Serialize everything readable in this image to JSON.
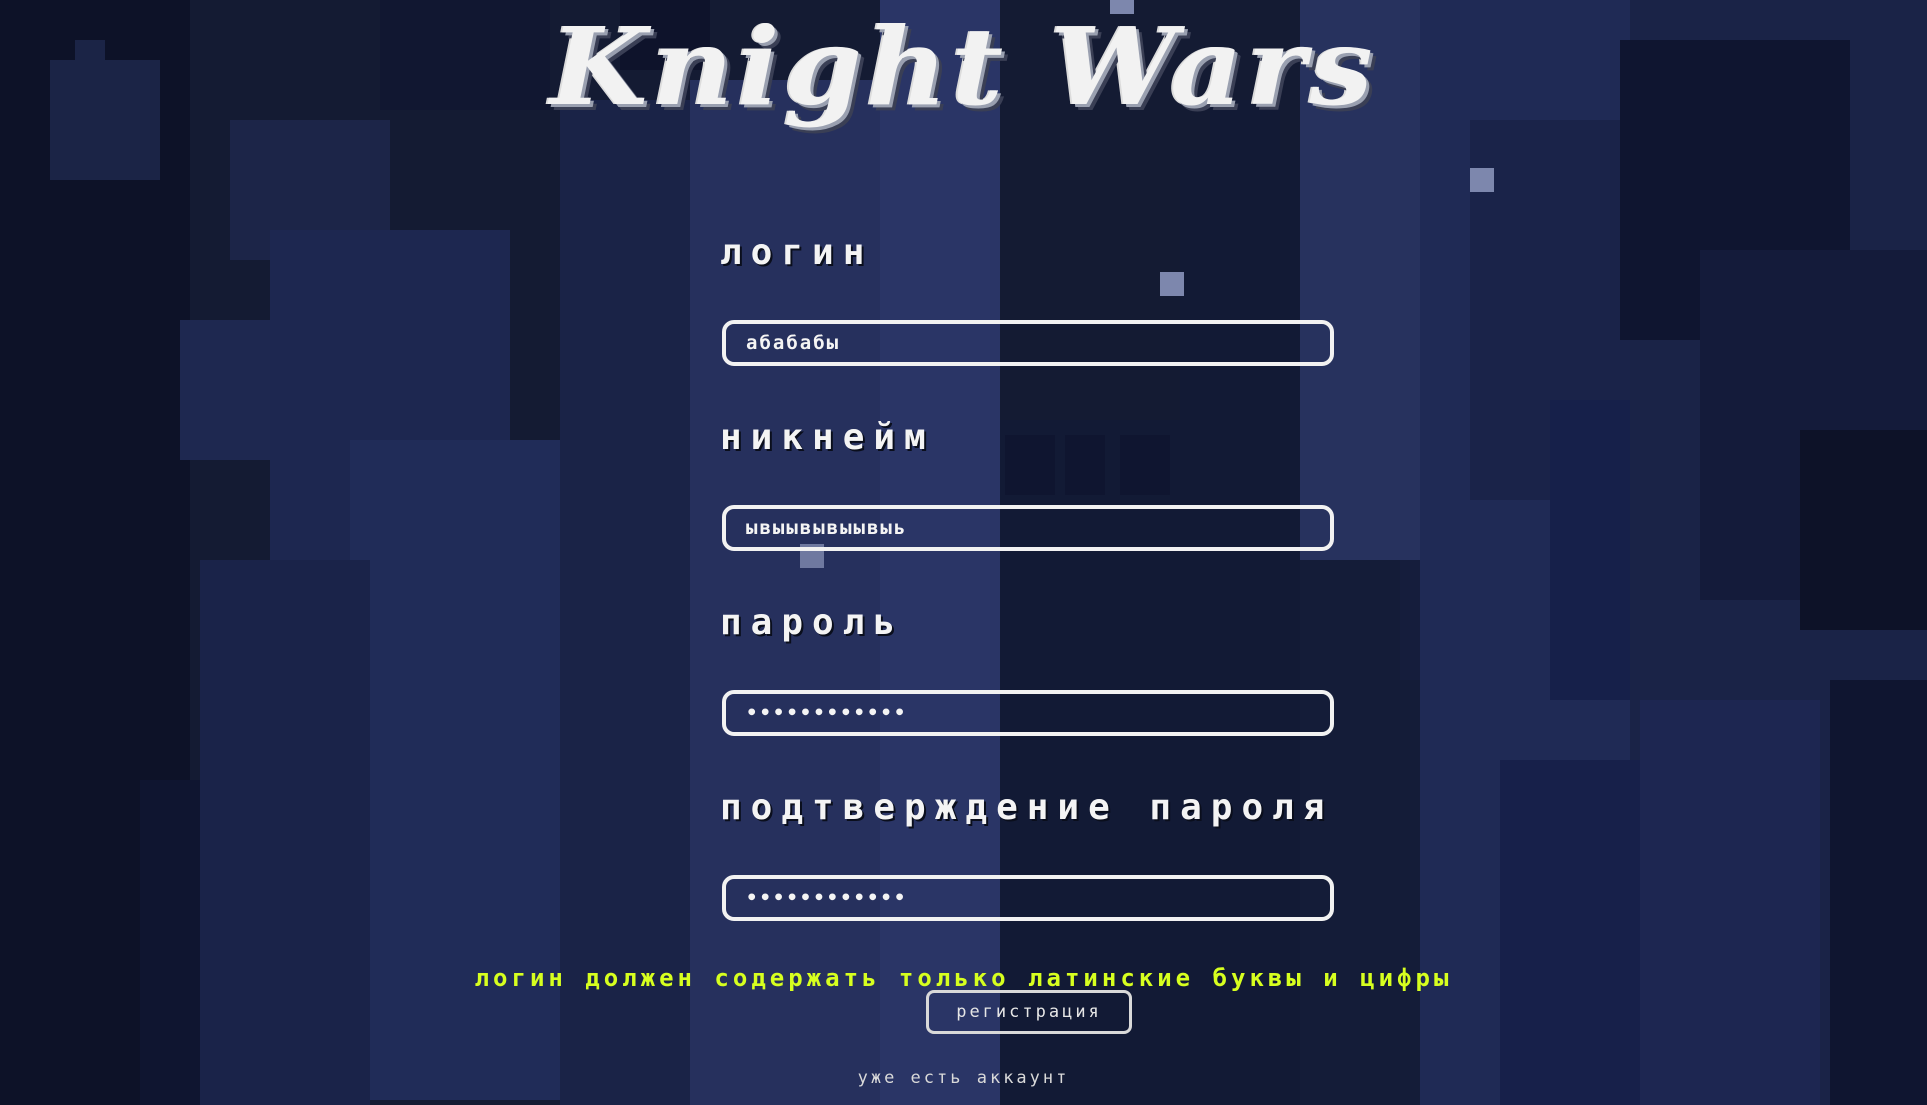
{
  "title": "Knight Wars",
  "form": {
    "login": {
      "label": "логин",
      "value": "абабабы"
    },
    "nickname": {
      "label": "никнейм",
      "value": "ывыывывыывыь"
    },
    "password": {
      "label": "пароль",
      "value": "••••••••••••"
    },
    "confirm": {
      "label": "подтверждение пароля",
      "value": "••••••••••••"
    }
  },
  "error_message": "логин должен содержать только латинские буквы и цифры",
  "register_button": "регистрация",
  "have_account_link": "уже есть аккаунт",
  "colors": {
    "background": "#141b33",
    "text": "#f4f4f4",
    "error": "#d7ff1f"
  }
}
